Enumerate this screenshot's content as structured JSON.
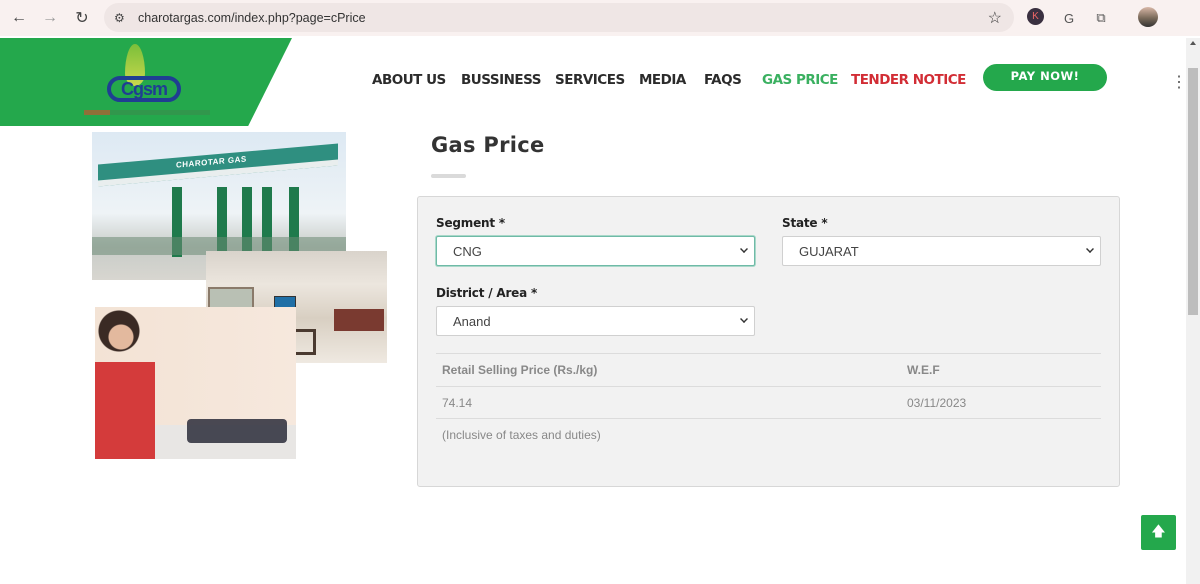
{
  "browser": {
    "url": "charotargas.com/index.php?page=cPrice",
    "icons": {
      "back": "←",
      "forward": "→",
      "reload": "↻",
      "site_settings": "⚙",
      "bookmark": "☆",
      "extension_k": "K",
      "extension_g": "G",
      "extensions": "⧉",
      "menu": "⋮"
    }
  },
  "header": {
    "logo_text": "Cgsm",
    "nav": [
      {
        "label": "ABOUT US",
        "state": "normal"
      },
      {
        "label": "BUSSINESS",
        "state": "normal"
      },
      {
        "label": "SERVICES",
        "state": "normal"
      },
      {
        "label": "MEDIA",
        "state": "normal"
      },
      {
        "label": "FAQS",
        "state": "normal"
      },
      {
        "label": "GAS PRICE",
        "state": "active"
      },
      {
        "label": "TENDER NOTICE",
        "state": "highlight"
      }
    ],
    "pay_button": "PAY NOW!"
  },
  "gallery": {
    "station_sign": "CHAROTAR GAS"
  },
  "main": {
    "title": "Gas Price",
    "form": {
      "segment": {
        "label": "Segment *",
        "value": "CNG"
      },
      "state": {
        "label": "State *",
        "value": "GUJARAT"
      },
      "district": {
        "label": "District / Area *",
        "value": "Anand"
      }
    },
    "table": {
      "headers": [
        "Retail Selling Price (Rs./kg)",
        "W.E.F"
      ],
      "rows": [
        [
          "74.14",
          "03/11/2023"
        ]
      ],
      "note": "(Inclusive of taxes and duties)"
    }
  },
  "scroll_top": {
    "icon": "🡅"
  },
  "colors": {
    "brand_green": "#24a84c",
    "active_nav": "#3ab060",
    "tender_red": "#d22d35",
    "logo_blue": "#1f3e92"
  }
}
